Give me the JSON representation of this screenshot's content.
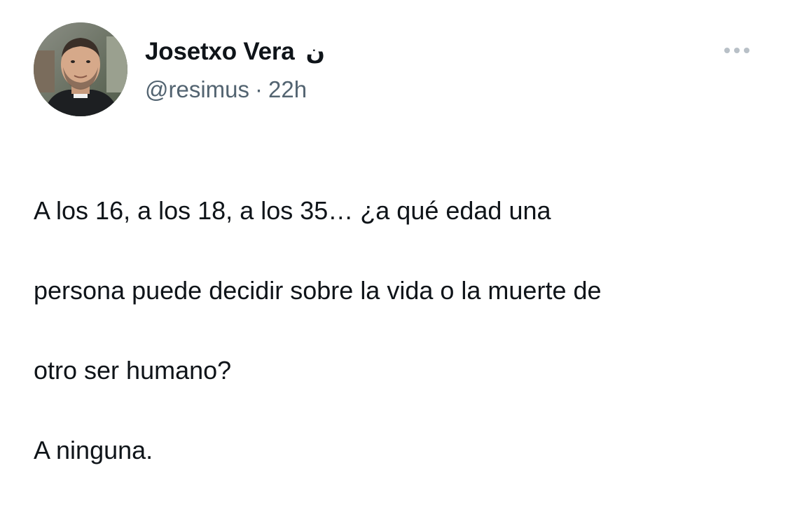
{
  "tweet": {
    "author": {
      "display_name": "Josetxo Vera",
      "name_symbol": "ن",
      "handle": "@resimus",
      "separator": "·",
      "time": "22h"
    },
    "more_icon": "more-horizontal-icon",
    "text_lines": [
      "A los 16, a los 18, a los 35… ¿a qué edad una",
      "persona puede decidir sobre la vida o la muerte de",
      "otro ser humano?",
      "A ninguna."
    ]
  },
  "colors": {
    "text_primary": "#0f1419",
    "text_secondary": "#536471",
    "more_dots": "#b8c0c7",
    "background": "#ffffff"
  }
}
